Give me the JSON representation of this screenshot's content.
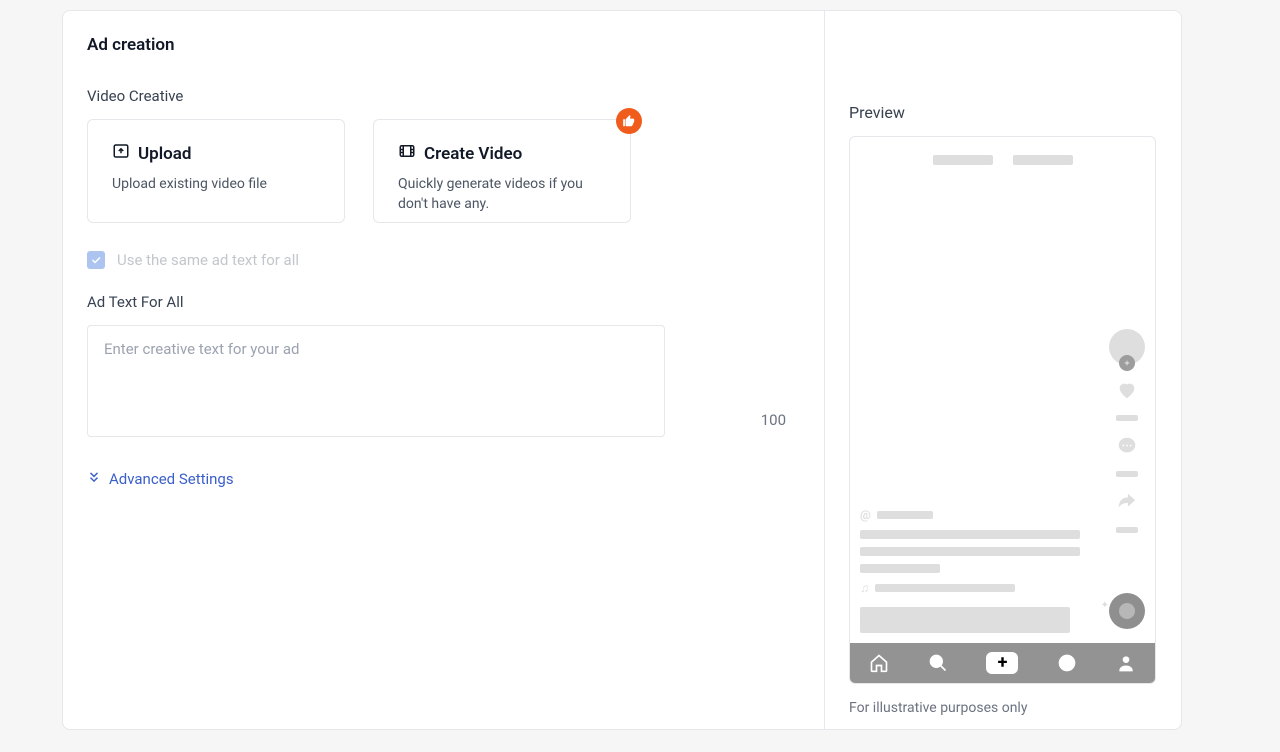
{
  "page_title": "Ad creation",
  "video_creative": {
    "label": "Video Creative",
    "upload": {
      "title": "Upload",
      "desc": "Upload existing video file"
    },
    "create": {
      "title": "Create Video",
      "desc": "Quickly generate videos if you don't have any."
    }
  },
  "same_text": {
    "label": "Use the same ad text for all",
    "checked": true
  },
  "ad_text": {
    "label": "Ad Text For All",
    "placeholder": "Enter creative text for your ad",
    "value": "",
    "char_limit": "100"
  },
  "advanced_label": "Advanced Settings",
  "preview": {
    "title": "Preview",
    "disclaimer": "For illustrative purposes only"
  }
}
